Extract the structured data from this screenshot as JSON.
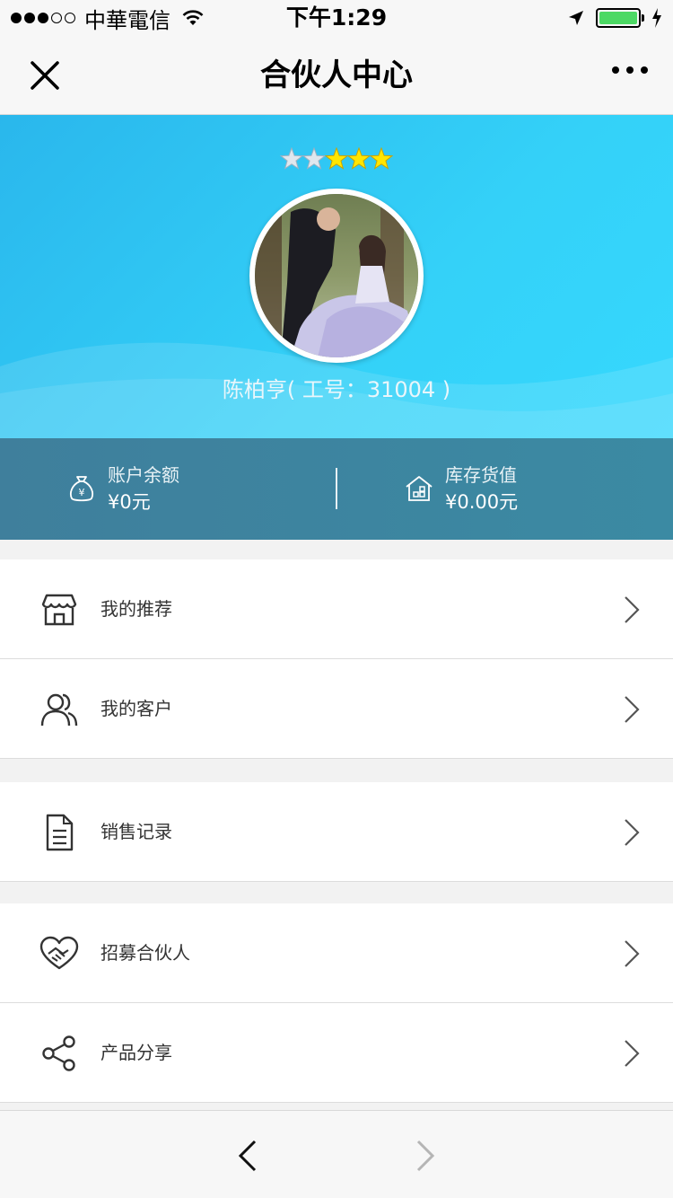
{
  "status_bar": {
    "carrier": "中華電信",
    "time": "下午1:29",
    "signal_bars_filled": 3,
    "signal_bars_total": 5,
    "battery_level": 1.0,
    "battery_color": "#4cd964"
  },
  "nav": {
    "title": "合伙人中心",
    "close_icon": "close-icon",
    "more_icon": "more-icon"
  },
  "profile": {
    "rating_filled": 3,
    "rating_total": 5,
    "name": "陈柏亨( 工号：31004 )",
    "hero_color": "#34d1f8"
  },
  "stats": {
    "balance_label": "账户余额",
    "balance_value": "¥0元",
    "inventory_label": "库存货值",
    "inventory_value": "¥0.00元"
  },
  "menu": {
    "recommend": {
      "label": "我的推荐",
      "icon": "store-icon"
    },
    "customers": {
      "label": "我的客户",
      "icon": "users-icon"
    },
    "sales": {
      "label": "销售记录",
      "icon": "document-icon"
    },
    "recruit": {
      "label": "招募合伙人",
      "icon": "handshake-icon"
    },
    "share": {
      "label": "产品分享",
      "icon": "share-icon"
    }
  },
  "toolbar": {
    "back_icon": "back-icon",
    "forward_icon": "forward-icon"
  }
}
